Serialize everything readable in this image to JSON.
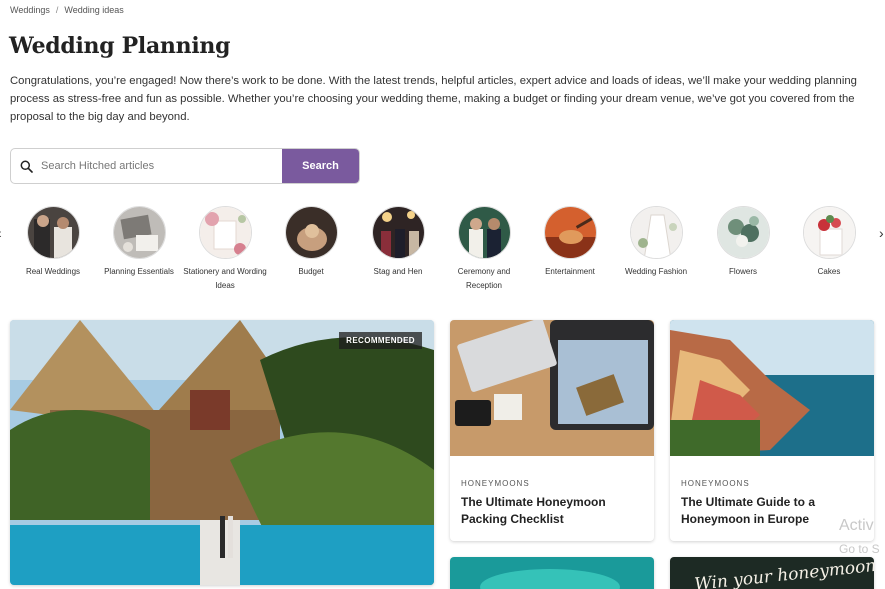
{
  "breadcrumb": {
    "items": [
      "Weddings",
      "Wedding ideas"
    ],
    "separator": "/"
  },
  "page": {
    "title": "Wedding Planning",
    "intro": "Congratulations, you’re engaged! Now there’s work to be done. With the latest trends, helpful articles, expert advice and loads of ideas, we’ll make your wedding planning process as stress-free and fun as possible. Whether you’re choosing your wedding theme, making a budget or finding your dream venue, we’ve got you covered from the proposal to the big day and beyond."
  },
  "search": {
    "placeholder": "Search Hitched articles",
    "value": "",
    "button_label": "Search",
    "accent_color": "#7a5a9e"
  },
  "categories": {
    "prev_icon": "chevron-left-icon",
    "next_icon": "chevron-right-icon",
    "items": [
      {
        "label": "Real Weddings"
      },
      {
        "label": "Planning Essentials"
      },
      {
        "label": "Stationery and Wording Ideas"
      },
      {
        "label": "Budget"
      },
      {
        "label": "Stag and Hen"
      },
      {
        "label": "Ceremony and Reception"
      },
      {
        "label": "Entertainment"
      },
      {
        "label": "Wedding Fashion"
      },
      {
        "label": "Flowers"
      },
      {
        "label": "Cakes"
      }
    ]
  },
  "articles": {
    "featured": {
      "badge": "RECOMMENDED"
    },
    "cards": [
      {
        "tag": "HONEYMOONS",
        "title": "The Ultimate Honeymoon Packing Checklist"
      },
      {
        "tag": "HONEYMOONS",
        "title": "The Ultimate Guide to a Honeymoon in Europe"
      }
    ],
    "partial_card_text": "Win your honeymoon!"
  },
  "system_overlay": {
    "line1": "Activ",
    "line2": "Go to S"
  }
}
